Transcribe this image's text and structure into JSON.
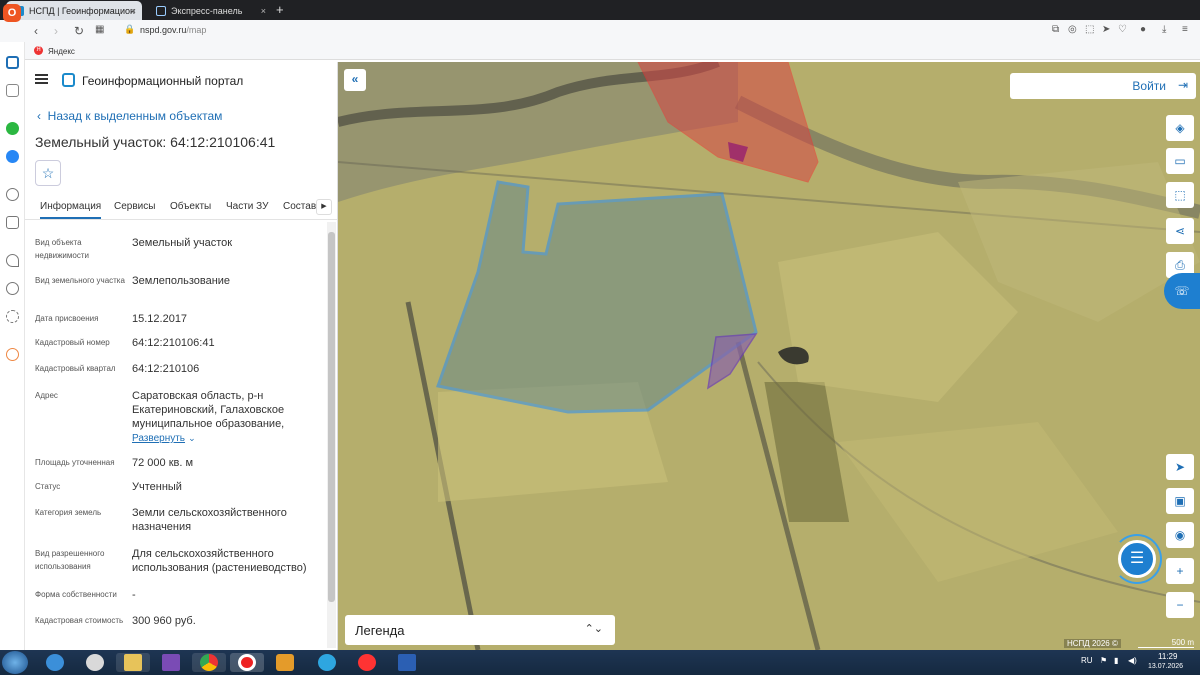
{
  "browser": {
    "tabs": [
      {
        "label": "НСПД | Геоинформацион",
        "close": "×"
      },
      {
        "label": "Экспресс-панель",
        "close": "×"
      }
    ],
    "new_tab": "+",
    "url_host": "nspd.gov.ru",
    "url_path": "/map",
    "bookmark": "Яндекс",
    "yandex_letter": "Я"
  },
  "header": {
    "title": "Геоинформационный портал"
  },
  "back_link": "Назад к выделенным объектам",
  "object_title": "Земельный участок: 64:12:210106:41",
  "tabs": [
    "Информация",
    "Сервисы",
    "Объекты",
    "Части ЗУ",
    "Состав"
  ],
  "fields": [
    {
      "k": "Вид объекта недвижимости",
      "v": "Земельный участок"
    },
    {
      "k": "Вид земельного участка",
      "v": "Землепользование"
    },
    {
      "k": "Дата присвоения",
      "v": "15.12.2017"
    },
    {
      "k": "Кадастровый номер",
      "v": "64:12:210106:41"
    },
    {
      "k": "Кадастровый квартал",
      "v": "64:12:210106"
    },
    {
      "k": "Адрес",
      "v": "Саратовская область, р-н Екатериновский, Галаховское муниципальное образование,"
    },
    {
      "k": "Площадь уточненная",
      "v": "72 000 кв. м"
    },
    {
      "k": "Статус",
      "v": "Учтенный"
    },
    {
      "k": "Категория земель",
      "v": "Земли сельскохозяйственного назначения"
    },
    {
      "k": "Вид разрешенного использования",
      "v": "Для сельскохозяйственного использования (растениеводство)"
    },
    {
      "k": "Форма собственности",
      "v": "-"
    },
    {
      "k": "Кадастровая стоимость",
      "v": "300 960 руб."
    }
  ],
  "expand_label": "Развернуть",
  "map": {
    "login": "Войти",
    "legend": "Легенда",
    "copyright": "НСПД 2026 ©",
    "scale": "500 m",
    "zoom_in": "+",
    "zoom_out": "−"
  },
  "taskbar": {
    "lang": "RU",
    "time": "11:29",
    "date": "13.07.2026"
  },
  "colors": {
    "accent": "#1f6fb5",
    "parcel": "#2a8cf0"
  }
}
